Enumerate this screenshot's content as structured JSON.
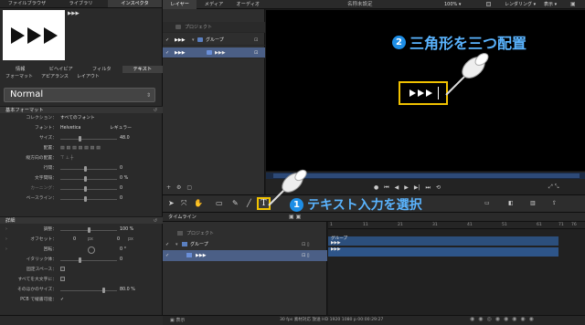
{
  "left_panel": {
    "tabs": [
      "ファイルブラウザ",
      "ライブラリ",
      "インスペクタ"
    ],
    "preview_name": "▶▶▶",
    "subtabs": [
      "情報",
      "ビヘイビア",
      "フィルタ",
      "テキスト"
    ],
    "subtabs2": [
      "フォーマット",
      "アピアランス",
      "レイアウト"
    ],
    "preset": "Normal",
    "section_basic": "基本フォーマット",
    "collection_label": "コレクション：",
    "collection_value": "すべてのフォント",
    "font_label": "フォント：",
    "font_value": "Helvetica",
    "font_style": "レギュラー",
    "size_label": "サイズ：",
    "size_value": "48.0",
    "align_label": "配置：",
    "vdir_label": "縦方向の配置：",
    "linespacing_label": "行間：",
    "linespacing_value": "0",
    "tracking_label": "文字間隔：",
    "tracking_value": "0 %",
    "kerning_label": "カーニング：",
    "kerning_value": "0",
    "baseline_label": "ベースライン：",
    "baseline_value": "0",
    "section_detail": "詳細",
    "scale_label": "調整：",
    "scale_value": "100 %",
    "offset_label": "オフセット：",
    "offset_x": "0",
    "offset_unit": "px",
    "offset_y": "0",
    "offset_unit2": "px",
    "rotation_label": "回転：",
    "rotation_value": "0 °",
    "italic_label": "イタリック体：",
    "italic_value": "0",
    "fixed_label": "固定スペース：",
    "caps_label": "すべてを大文字に：",
    "smallcaps_label": "そのほかのサイズ：",
    "smallcaps_value": "80.0 %",
    "pcb_label": "PCB で縦書可能：",
    "bottom_label": "開く"
  },
  "top": {
    "tabs": [
      "レイヤー",
      "メディア",
      "オーディオ"
    ],
    "title": "名称未設定",
    "zoom": "100%",
    "render": "レンダリング",
    "display": "表示"
  },
  "layers": {
    "project": "プロジェクト",
    "group": "グループ",
    "text_layer": "▶▶▶"
  },
  "canvas": {
    "annotation2_num": "2",
    "annotation2_text": "三角形を三つ配置"
  },
  "toolbar": {
    "text_tool": "T",
    "annotation1_num": "1",
    "annotation1_text": "テキスト入力を選択"
  },
  "timeline": {
    "title": "タイムライン",
    "project": "プロジェクト",
    "group": "グループ",
    "text_layer": "▶▶▶",
    "bar_group": "グループ",
    "bar_text1": "▶▶▶",
    "bar_text2": "▶▶▶",
    "ruler": [
      "1",
      "11",
      "21",
      "31",
      "41",
      "51",
      "61",
      "71",
      "76"
    ]
  },
  "status": {
    "text": "30 fps 素材対応 放送 HD 1920 1080 p 00:00:29:27"
  },
  "colors": {
    "accent": "#1e8ee6",
    "highlight": "#f1c200",
    "selection": "#4b5f86",
    "timeline_bar": "#2c4f7c"
  }
}
